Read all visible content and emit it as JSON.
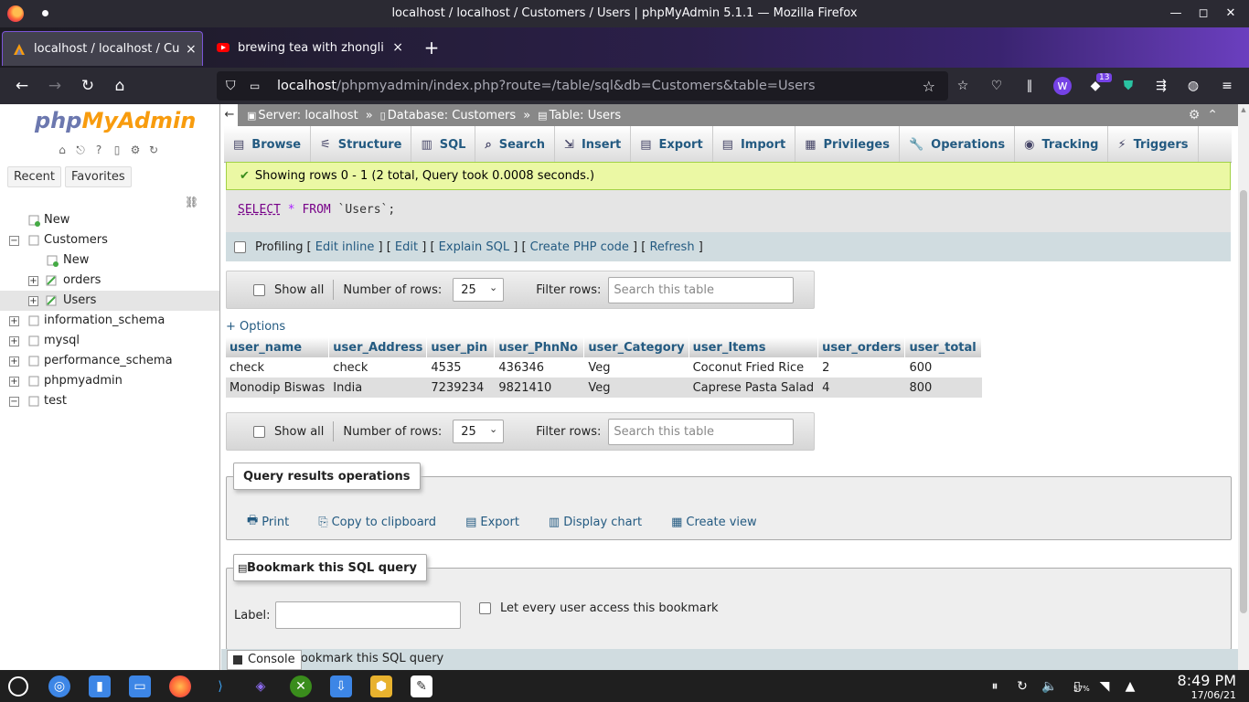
{
  "window": {
    "title": "localhost / localhost / Customers / Users | phpMyAdmin 5.1.1 — Mozilla Firefox",
    "minimize": "—",
    "maximize": "◻",
    "close": "✕"
  },
  "tabs": [
    {
      "label": "localhost / localhost / Customers / Users | phpMyAdmin 5.1.1",
      "close": "×"
    },
    {
      "label": "brewing tea with zhongli",
      "close": "×"
    }
  ],
  "newtab": "+",
  "nav": {
    "back": "←",
    "forward": "→",
    "reload": "↻",
    "home": "⌂",
    "url_host": "localhost",
    "url_path": "/phpmyadmin/index.php?route=/table/sql&db=Customers&table=Users",
    "extension_badge": "13"
  },
  "sidebar": {
    "logo_php": "php",
    "logo_myadmin": "MyAdmin",
    "tabs": [
      "Recent",
      "Favorites"
    ],
    "tree": [
      {
        "label": "New",
        "level": 1,
        "expander": ""
      },
      {
        "label": "Customers",
        "level": 0,
        "expander": "−"
      },
      {
        "label": "New",
        "level": 2,
        "expander": ""
      },
      {
        "label": "orders",
        "level": 2,
        "expander": "+"
      },
      {
        "label": "Users",
        "level": 2,
        "expander": "+",
        "selected": true
      },
      {
        "label": "information_schema",
        "level": 0,
        "expander": "+"
      },
      {
        "label": "mysql",
        "level": 0,
        "expander": "+"
      },
      {
        "label": "performance_schema",
        "level": 0,
        "expander": "+"
      },
      {
        "label": "phpmyadmin",
        "level": 0,
        "expander": "+"
      },
      {
        "label": "test",
        "level": 0,
        "expander": "−"
      }
    ]
  },
  "breadcrumb": {
    "server": "Server: localhost",
    "database": "Database: Customers",
    "table": "Table: Users",
    "sep": "»"
  },
  "menu": [
    {
      "label": "Browse",
      "icon": "▤"
    },
    {
      "label": "Structure",
      "icon": "⚟"
    },
    {
      "label": "SQL",
      "icon": "▥"
    },
    {
      "label": "Search",
      "icon": "⌕"
    },
    {
      "label": "Insert",
      "icon": "⇲"
    },
    {
      "label": "Export",
      "icon": "▤"
    },
    {
      "label": "Import",
      "icon": "▤"
    },
    {
      "label": "Privileges",
      "icon": "▦"
    },
    {
      "label": "Operations",
      "icon": "🔧"
    },
    {
      "label": "Tracking",
      "icon": "◉"
    },
    {
      "label": "Triggers",
      "icon": "⚡"
    }
  ],
  "result": {
    "message": "Showing rows 0 - 1 (2 total, Query took 0.0008 seconds.)",
    "sql_select": "SELECT",
    "sql_star": "*",
    "sql_from": "FROM",
    "sql_table": "`Users`;",
    "profiling": "Profiling",
    "profiling_links": [
      "Edit inline",
      "Edit",
      "Explain SQL",
      "Create PHP code",
      "Refresh"
    ]
  },
  "navpanel": {
    "show_all": "Show all",
    "number_of_rows_label": "Number of rows:",
    "rows_value": "25",
    "filter_label": "Filter rows:",
    "filter_placeholder": "Search this table"
  },
  "options_link": "+ Options",
  "table": {
    "columns": [
      "user_name",
      "user_Address",
      "user_pin",
      "user_PhnNo",
      "user_Category",
      "user_Items",
      "user_orders",
      "user_total"
    ],
    "rows": [
      [
        "check",
        "check",
        "4535",
        "436346",
        "Veg",
        "Coconut Fried Rice",
        "2",
        "600"
      ],
      [
        "Monodip Biswas",
        "India",
        "7239234",
        "9821410",
        "Veg",
        "Caprese Pasta Salad",
        "4",
        "800"
      ]
    ]
  },
  "query_ops": {
    "legend": "Query results operations",
    "items": [
      {
        "label": "Print",
        "icon": "🖶"
      },
      {
        "label": "Copy to clipboard",
        "icon": "⎘"
      },
      {
        "label": "Export",
        "icon": "▤"
      },
      {
        "label": "Display chart",
        "icon": "▥"
      },
      {
        "label": "Create view",
        "icon": "▦"
      }
    ]
  },
  "bookmark": {
    "legend": "Bookmark this SQL query",
    "label": "Label:",
    "share": "Let every user access this bookmark",
    "hidden_button": "Bookmark this SQL query"
  },
  "console": "Console",
  "taskbar": {
    "time": "8:49 PM",
    "date": "17/06/21",
    "battery": "57%"
  },
  "colors": {
    "accent": "#235a81",
    "success_bg": "#ebf8a4",
    "firefox_dark": "#2b2a33"
  }
}
